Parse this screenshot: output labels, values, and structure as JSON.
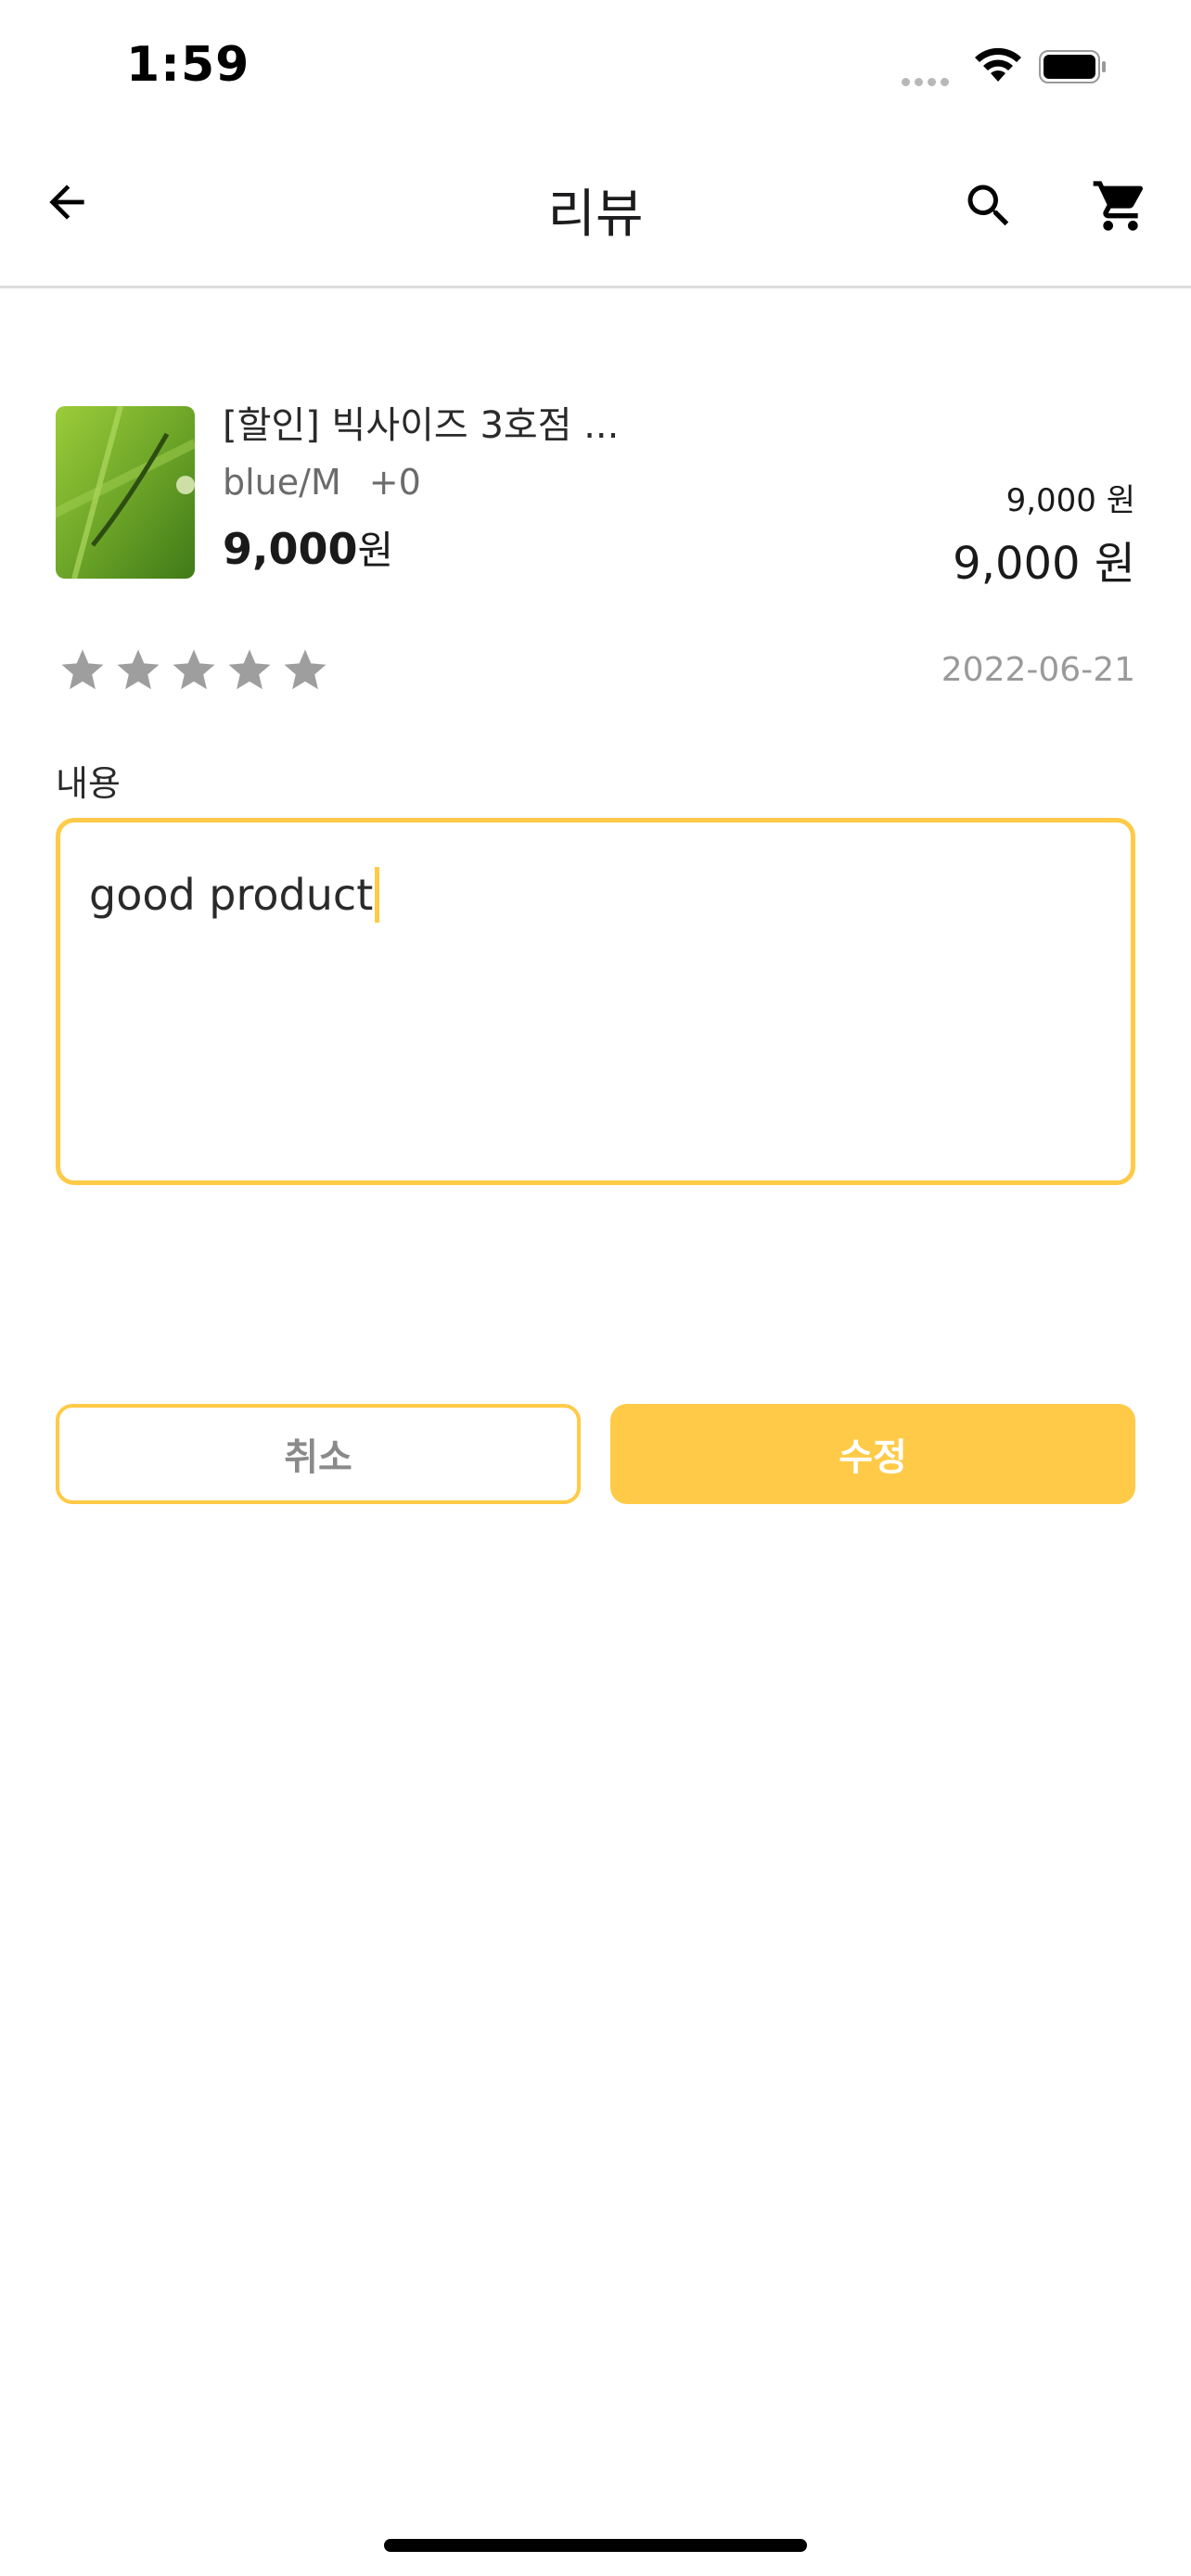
{
  "status_bar": {
    "time": "1:59",
    "icons": [
      "signal-dots-icon",
      "wifi-icon",
      "battery-icon"
    ]
  },
  "nav": {
    "title": "리뷰",
    "icons": {
      "back": "arrow-left-icon",
      "search": "search-icon",
      "cart": "cart-icon"
    }
  },
  "product": {
    "name": "[할인] 빅사이즈 3호점 ...",
    "option": "blue/M",
    "option_extra": "+0",
    "price": "9,000",
    "price_unit": "원",
    "unit_price": "9,000 원",
    "total_price": "9,000 원"
  },
  "review": {
    "rating": 0,
    "rating_max": 5,
    "date": "2022-06-21",
    "content_label": "내용",
    "content_value": "good product"
  },
  "buttons": {
    "cancel_label": "취소",
    "edit_label": "수정"
  },
  "colors": {
    "accent": "#ffca47",
    "star_inactive": "#9e9e9e",
    "muted_text": "#9a9a9a"
  }
}
